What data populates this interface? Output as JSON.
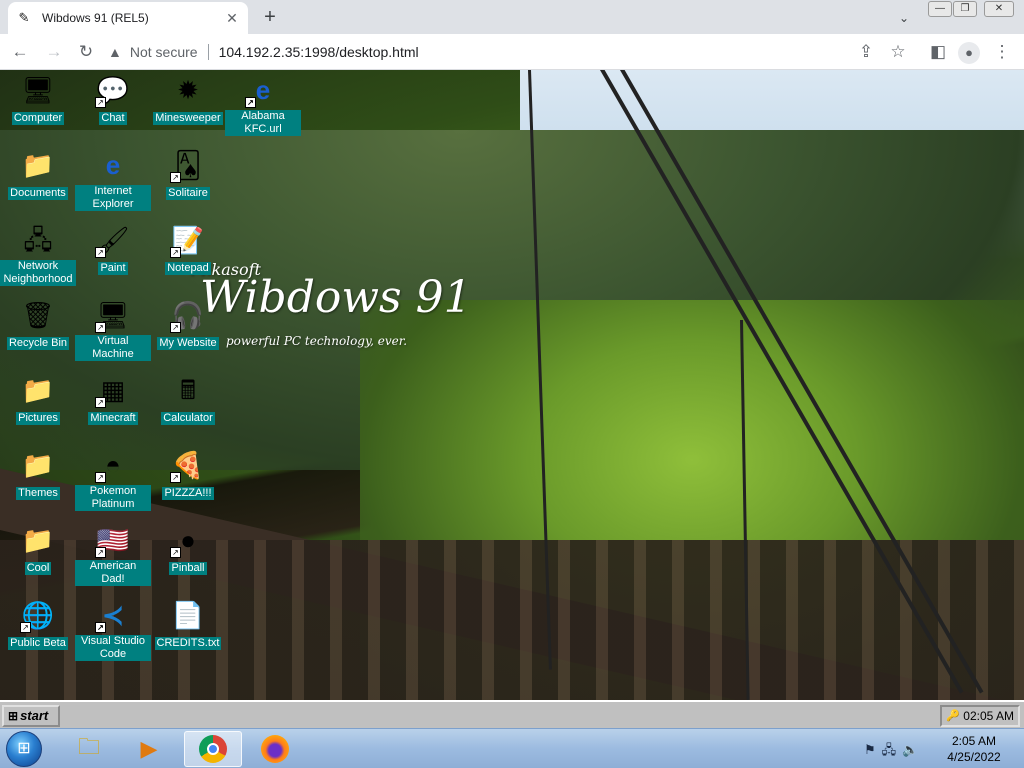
{
  "browser": {
    "tab_title": "Wibdows 91 (REL5)",
    "security_label": "Not secure",
    "url": "104.192.2.35:1998/desktop.html"
  },
  "logo": {
    "brand": "Mikasoft",
    "name": "Wibdows 91",
    "tagline": "powerful PC technology, ever."
  },
  "desktop_icons": [
    {
      "label": "Computer",
      "icon": "computer-icon"
    },
    {
      "label": "Chat",
      "icon": "chat-icon"
    },
    {
      "label": "Minesweeper",
      "icon": "mine-icon"
    },
    {
      "label": "Alabama KFC.url",
      "icon": "ie-icon"
    },
    {
      "label": "Documents",
      "icon": "folder-icon"
    },
    {
      "label": "Internet Explorer",
      "icon": "ie-icon"
    },
    {
      "label": "Solitaire",
      "icon": "cards-icon"
    },
    {
      "label": "Network Neighborhood",
      "icon": "network-icon"
    },
    {
      "label": "Paint",
      "icon": "paint-icon"
    },
    {
      "label": "Notepad",
      "icon": "notepad-icon"
    },
    {
      "label": "Recycle Bin",
      "icon": "recycle-bin-icon"
    },
    {
      "label": "Virtual Machine",
      "icon": "computer-icon"
    },
    {
      "label": "My Website",
      "icon": "headphones-icon"
    },
    {
      "label": "Pictures",
      "icon": "folder-icon"
    },
    {
      "label": "Minecraft",
      "icon": "minecraft-icon"
    },
    {
      "label": "Calculator",
      "icon": "calculator-icon"
    },
    {
      "label": "Themes",
      "icon": "folder-icon"
    },
    {
      "label": "Pokemon Platinum",
      "icon": "pokemon-icon"
    },
    {
      "label": "PIZZZA!!!",
      "icon": "pizza-icon"
    },
    {
      "label": "Cool",
      "icon": "folder-icon"
    },
    {
      "label": "American Dad!",
      "icon": "flag-icon"
    },
    {
      "label": "Pinball",
      "icon": "pinball-icon"
    },
    {
      "label": "Public Beta",
      "icon": "globe-icon"
    },
    {
      "label": "Visual Studio Code",
      "icon": "vscode-icon"
    },
    {
      "label": "CREDITS.txt",
      "icon": "text-file-icon"
    }
  ],
  "w91_taskbar": {
    "start_label": "start",
    "clock": "02:05 AM"
  },
  "win7_taskbar": {
    "time": "2:05 AM",
    "date": "4/25/2022"
  },
  "colors": {
    "icon_label_bg": "#008080",
    "taskbar_gray": "#c0c0c0"
  }
}
